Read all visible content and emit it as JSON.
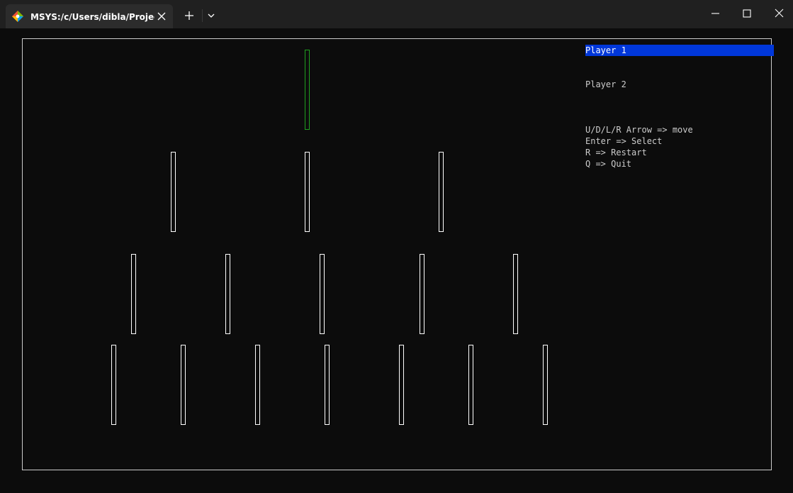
{
  "window": {
    "tab_title": "MSYS:/c/Users/dibla/Projects,"
  },
  "colors": {
    "background": "#0c0c0c",
    "titlebar": "#202020",
    "tab": "#2c2c2c",
    "stick": "#ffffff",
    "selected_stick": "#1fa01f",
    "active_player_highlight": "#0037da",
    "text": "#cccccc"
  },
  "icons": {
    "tab_icon": "git-bash-diamond-icon",
    "close": "close-icon",
    "new_tab": "plus-icon",
    "dropdown": "chevron-down-icon",
    "minimize": "minimize-icon",
    "maximize": "maximize-icon",
    "window_close": "close-icon"
  },
  "game": {
    "rows": [
      {
        "sticks": 1,
        "selected_index": 0
      },
      {
        "sticks": 3,
        "selected_index": null
      },
      {
        "sticks": 5,
        "selected_index": null
      },
      {
        "sticks": 7,
        "selected_index": null
      }
    ]
  },
  "panel": {
    "players": [
      {
        "label": "Player 1",
        "active": true
      },
      {
        "label": "Player 2",
        "active": false
      }
    ],
    "controls": [
      "U/D/L/R Arrow => move",
      "Enter => Select",
      "R => Restart",
      "Q => Quit"
    ]
  }
}
